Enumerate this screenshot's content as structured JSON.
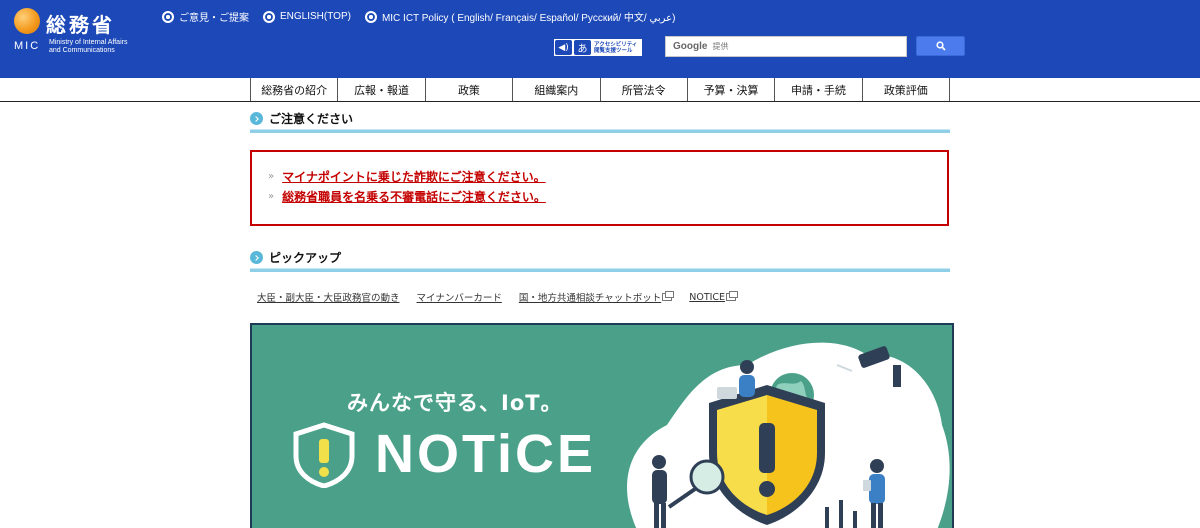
{
  "header": {
    "logo_title": "総務省",
    "logo_abbr": "MIC",
    "logo_sub_line1": "Ministry of Internal Affairs",
    "logo_sub_line2": "and Communications",
    "top_links": [
      "ご意見・ご提案",
      "ENGLISH(TOP)",
      "MIC ICT Policy ( English/ Français/ Español/ Русский/ 中文/ عربي)"
    ],
    "accessibility_tool_label_line1": "アクセシビリティ",
    "accessibility_tool_label_line2": "閲覧支援ツール",
    "search_engine_label": "Google",
    "search_placeholder": "提供",
    "brand_color": "#1c48b8"
  },
  "nav": {
    "items": [
      "総務省の紹介",
      "広報・報道",
      "政策",
      "組織案内",
      "所管法令",
      "予算・決算",
      "申請・手続",
      "政策評価"
    ]
  },
  "caution": {
    "heading": "ご注意ください",
    "items": [
      "マイナポイントに乗じた詐欺にご注意ください。",
      "総務省職員を名乗る不審電話にご注意ください。"
    ],
    "alert_color": "#c40000"
  },
  "pickup": {
    "heading": "ピックアップ",
    "links": [
      {
        "label": "大臣・副大臣・大臣政務官の動き",
        "external": false
      },
      {
        "label": "マイナンバーカード",
        "external": false
      },
      {
        "label": "国・地方共通相談チャットボット",
        "external": true
      },
      {
        "label": "NOTICE",
        "external": true
      }
    ]
  },
  "banner": {
    "tagline": "みんなで守る、IoT。",
    "title": "NOTiCE",
    "background_color": "#4aa088"
  }
}
